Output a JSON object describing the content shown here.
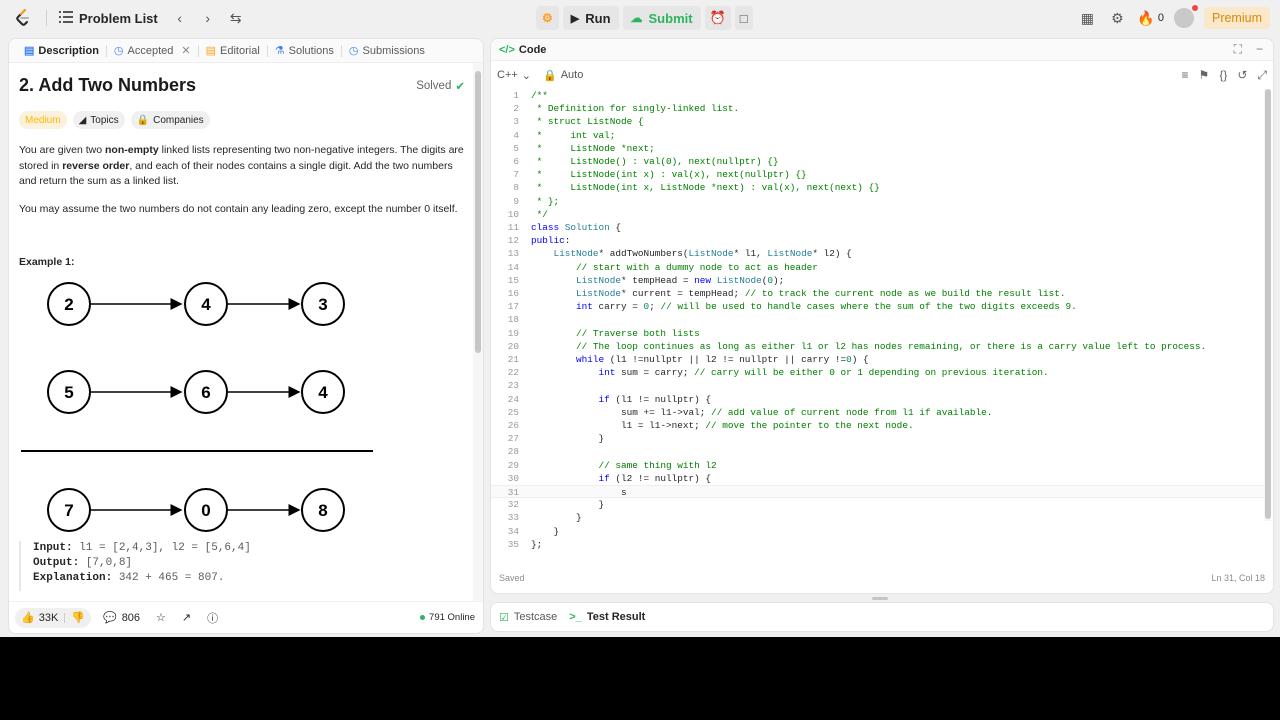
{
  "header": {
    "problem_list_label": "Problem List",
    "run_label": "Run",
    "submit_label": "Submit",
    "streak_count": "0",
    "premium_label": "Premium",
    "icons": [
      "logo-icon",
      "list-icon",
      "chevron-left-icon",
      "chevron-right-icon",
      "shuffle-icon",
      "debug-icon",
      "play-icon",
      "upload-icon",
      "alarm-icon",
      "note-icon",
      "layout-icon",
      "gear-icon",
      "fire-icon",
      "avatar"
    ]
  },
  "left": {
    "tabs": [
      {
        "label": "Description",
        "icon": "document-icon"
      },
      {
        "label": "Accepted",
        "icon": "history-icon"
      },
      {
        "label": "Editorial",
        "icon": "book-icon"
      },
      {
        "label": "Solutions",
        "icon": "flask-icon"
      },
      {
        "label": "Submissions",
        "icon": "history-icon"
      }
    ],
    "title": "2. Add Two Numbers",
    "solved_label": "Solved",
    "chips": [
      "Medium",
      "Topics",
      "Companies"
    ],
    "para1_a": "You are given two ",
    "para1_b": "non-empty",
    "para1_c": " linked lists representing two non-negative integers. The digits are stored in ",
    "para1_d": "reverse order",
    "para1_e": ", and each of their nodes contains a single digit. Add the two numbers and return the sum as a linked list.",
    "para2": "You may assume the two numbers do not contain any leading zero, except the number 0 itself.",
    "example_label": "Example 1:",
    "diagram": {
      "row1": [
        "2",
        "4",
        "3"
      ],
      "row2": [
        "5",
        "6",
        "4"
      ],
      "row3": [
        "7",
        "0",
        "8"
      ]
    },
    "io": {
      "input_label": "Input:",
      "input_value": " l1 = [2,4,3], l2 = [5,6,4]",
      "output_label": "Output:",
      "output_value": " [7,0,8]",
      "explanation_label": "Explanation:",
      "explanation_value": " 342 + 465 = 807."
    },
    "footer": {
      "likes": "33K",
      "comments": "806",
      "online": "791 Online"
    }
  },
  "right": {
    "tab_label": "Code",
    "language": "C++",
    "mode": "Auto",
    "status_saved": "Saved",
    "cursor_pos": "Ln 31, Col 18",
    "bottom_tabs": [
      "Testcase",
      "Test Result"
    ]
  },
  "code_lines": [
    "/**",
    " * Definition for singly-linked list.",
    " * struct ListNode {",
    " *     int val;",
    " *     ListNode *next;",
    " *     ListNode() : val(0), next(nullptr) {}",
    " *     ListNode(int x) : val(x), next(nullptr) {}",
    " *     ListNode(int x, ListNode *next) : val(x), next(next) {}",
    " * };",
    " */",
    "class Solution {",
    "public:",
    "    ListNode* addTwoNumbers(ListNode* l1, ListNode* l2) {",
    "        // start with a dummy node to act as header",
    "        ListNode* tempHead = new ListNode(0);",
    "        ListNode* current = tempHead; // to track the current node as we build the result list.",
    "        int carry = 0; // will be used to handle cases where the sum of the two digits exceeds 9.",
    "",
    "        // Traverse both lists",
    "        // The loop continues as long as either l1 or l2 has nodes remaining, or there is a carry value left to process.",
    "        while (l1 !=nullptr || l2 != nullptr || carry !=0) {",
    "            int sum = carry; // carry will be either 0 or 1 depending on previous iteration.",
    "",
    "            if (l1 != nullptr) {",
    "                sum += l1->val; // add value of current node from l1 if available.",
    "                l1 = l1->next; // move the pointer to the next node.",
    "            }",
    "",
    "            // same thing with l2",
    "            if (l2 != nullptr) {",
    "                s",
    "            }",
    "        }",
    "    }",
    "};"
  ]
}
